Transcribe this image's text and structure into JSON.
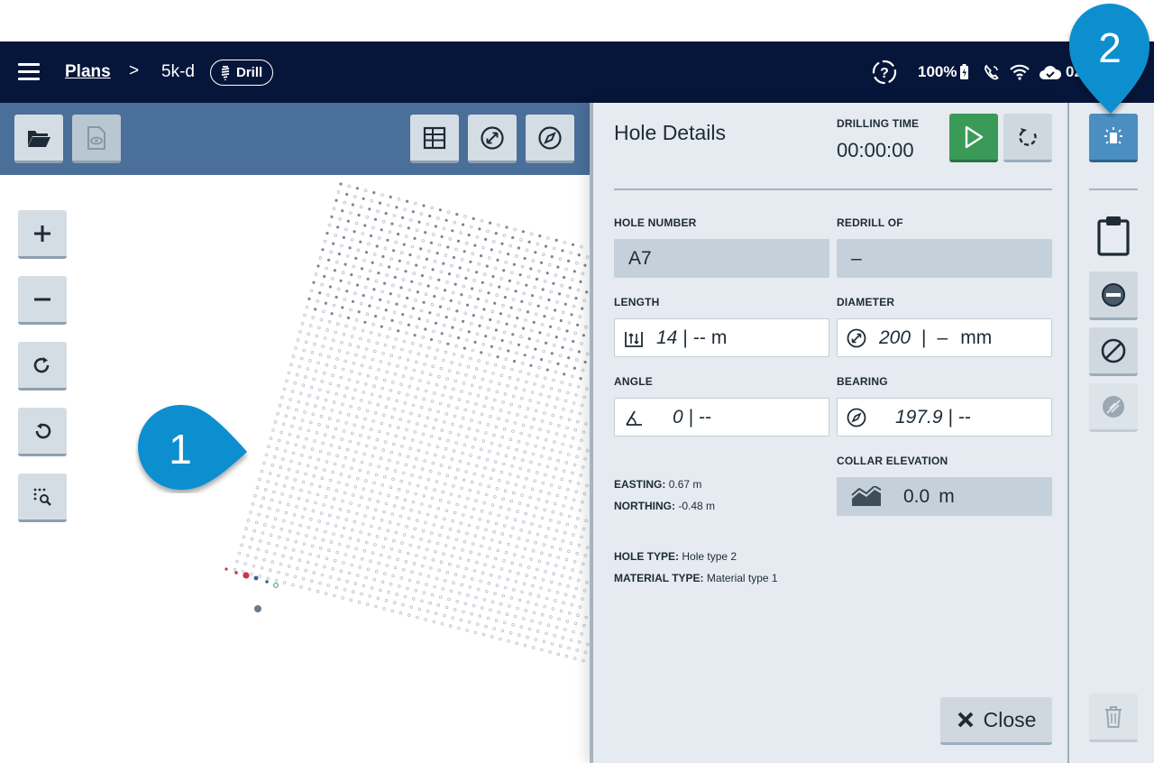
{
  "header": {
    "breadcrumb_root": "Plans",
    "breadcrumb_separator": ">",
    "plan_name": "5k-d",
    "mode_badge": "Drill",
    "battery_level": "100%",
    "clock_partial": "02"
  },
  "callouts": {
    "first": "1",
    "second": "2"
  },
  "panel": {
    "title": "Hole Details",
    "drilling_time_label": "DRILLING TIME",
    "drilling_time_value": "00:00:00",
    "hole_number_label": "HOLE NUMBER",
    "hole_number_value": "A7",
    "redrill_label": "REDRILL OF",
    "redrill_value": "–",
    "length_label": "LENGTH",
    "length_value": "14",
    "length_actual": "--",
    "length_unit": "m",
    "diameter_label": "DIAMETER",
    "diameter_value": "200",
    "diameter_actual": "–",
    "diameter_unit": "mm",
    "angle_label": "ANGLE",
    "angle_value": "0",
    "angle_actual": "--",
    "bearing_label": "BEARING",
    "bearing_value": "197.9",
    "bearing_actual": "--",
    "separator": "|",
    "collar_label": "COLLAR ELEVATION",
    "collar_value": "0.0",
    "collar_unit": "m",
    "easting_label": "EASTING:",
    "easting_value": "0.67 m",
    "northing_label": "NORTHING:",
    "northing_value": "-0.48 m",
    "hole_type_label": "HOLE TYPE:",
    "hole_type_value": "Hole type 2",
    "material_type_label": "MATERIAL TYPE:",
    "material_type_value": "Material type 1",
    "close_label": "Close"
  },
  "colors": {
    "topbar": "#06163a",
    "toolbar": "#4a6f99",
    "callout": "#0a8fcf",
    "play": "#3a9a58",
    "active_tool": "#4a8ec2",
    "panel_bg": "#e5ebf0"
  },
  "icons": {
    "toolbar": [
      "folder-open-icon",
      "preview-eye-icon",
      "grid-table-icon",
      "diameter-icon",
      "compass-icon"
    ],
    "zoom": [
      "zoom-in-icon",
      "zoom-out-icon",
      "rotate-clockwise-icon",
      "rotate-counterclockwise-icon",
      "zoom-to-selection-icon"
    ],
    "right": [
      "drill-hole-highlight-icon",
      "clipboard-icon",
      "remove-circle-icon",
      "no-entry-icon",
      "not-drilled-icon",
      "trash-icon"
    ]
  }
}
